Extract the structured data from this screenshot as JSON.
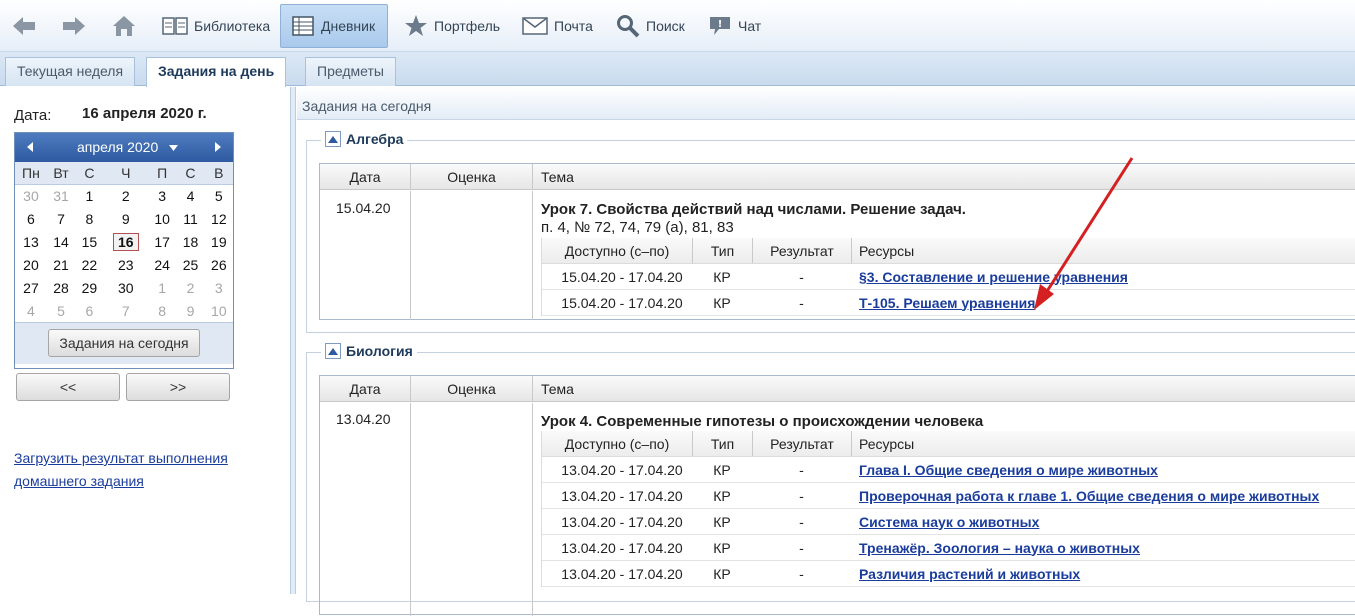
{
  "toolbar": {
    "items": [
      {
        "label": "Библиотека",
        "icon": "book-icon"
      },
      {
        "label": "Дневник",
        "icon": "diary-icon"
      },
      {
        "label": "Портфель",
        "icon": "star-icon"
      },
      {
        "label": "Почта",
        "icon": "mail-icon"
      },
      {
        "label": "Поиск",
        "icon": "search-icon"
      },
      {
        "label": "Чат",
        "icon": "chat-icon"
      }
    ]
  },
  "tabs": [
    {
      "label": "Текущая неделя"
    },
    {
      "label": "Задания на день"
    },
    {
      "label": "Предметы"
    }
  ],
  "left": {
    "date_label": "Дата:",
    "date_value": "16 апреля 2020 г.",
    "calendar": {
      "month_label": "апреля 2020",
      "weekdays": [
        "Пн",
        "Вт",
        "С",
        "Ч",
        "П",
        "С",
        "В"
      ],
      "weeks": [
        [
          "30",
          "31",
          "1",
          "2",
          "3",
          "4",
          "5"
        ],
        [
          "6",
          "7",
          "8",
          "9",
          "10",
          "11",
          "12"
        ],
        [
          "13",
          "14",
          "15",
          "16",
          "17",
          "18",
          "19"
        ],
        [
          "20",
          "21",
          "22",
          "23",
          "24",
          "25",
          "26"
        ],
        [
          "27",
          "28",
          "29",
          "30",
          "1",
          "2",
          "3"
        ],
        [
          "4",
          "5",
          "6",
          "7",
          "8",
          "9",
          "10"
        ]
      ],
      "today_button": "Задания на сегодня"
    },
    "prev_button": "<<",
    "next_button": ">>",
    "upload_link": "Загрузить результат выполнения домашнего задания"
  },
  "main": {
    "header": "Задания на сегодня",
    "columns": {
      "date": "Дата",
      "grade": "Оценка",
      "topic": "Тема"
    },
    "inner_columns": {
      "available": "Доступно (с–по)",
      "type": "Тип",
      "result": "Результат",
      "resources": "Ресурсы"
    },
    "sections": [
      {
        "subject": "Алгебра",
        "date": "15.04.20",
        "lesson": "Урок 7. Свойства действий над числами. Решение задач.",
        "note": "п. 4, № 72, 74, 79 (а), 81, 83",
        "rows": [
          {
            "available": "15.04.20 - 17.04.20",
            "type": "КР",
            "result": "-",
            "resource": "§3. Составление и решение уравнения"
          },
          {
            "available": "15.04.20 - 17.04.20",
            "type": "КР",
            "result": "-",
            "resource": "Т-105. Решаем уравнения"
          }
        ]
      },
      {
        "subject": "Биология",
        "date": "13.04.20",
        "lesson": "Урок 4. Современные гипотезы о происхождении человека",
        "note": "",
        "rows": [
          {
            "available": "13.04.20 - 17.04.20",
            "type": "КР",
            "result": "-",
            "resource": "Глава I. Общие сведения о мире животных"
          },
          {
            "available": "13.04.20 - 17.04.20",
            "type": "КР",
            "result": "-",
            "resource": "Проверочная работа к главе 1. Общие сведения о мире животных"
          },
          {
            "available": "13.04.20 - 17.04.20",
            "type": "КР",
            "result": "-",
            "resource": "Система наук о животных"
          },
          {
            "available": "13.04.20 - 17.04.20",
            "type": "КР",
            "result": "-",
            "resource": "Тренажёр. Зоология – наука о животных"
          },
          {
            "available": "13.04.20 - 17.04.20",
            "type": "КР",
            "result": "-",
            "resource": "Различия растений и животных"
          }
        ]
      }
    ]
  },
  "colors": {
    "accent": "#2d5aa0",
    "link": "#1a3c9c",
    "arrow": "#d42020"
  }
}
